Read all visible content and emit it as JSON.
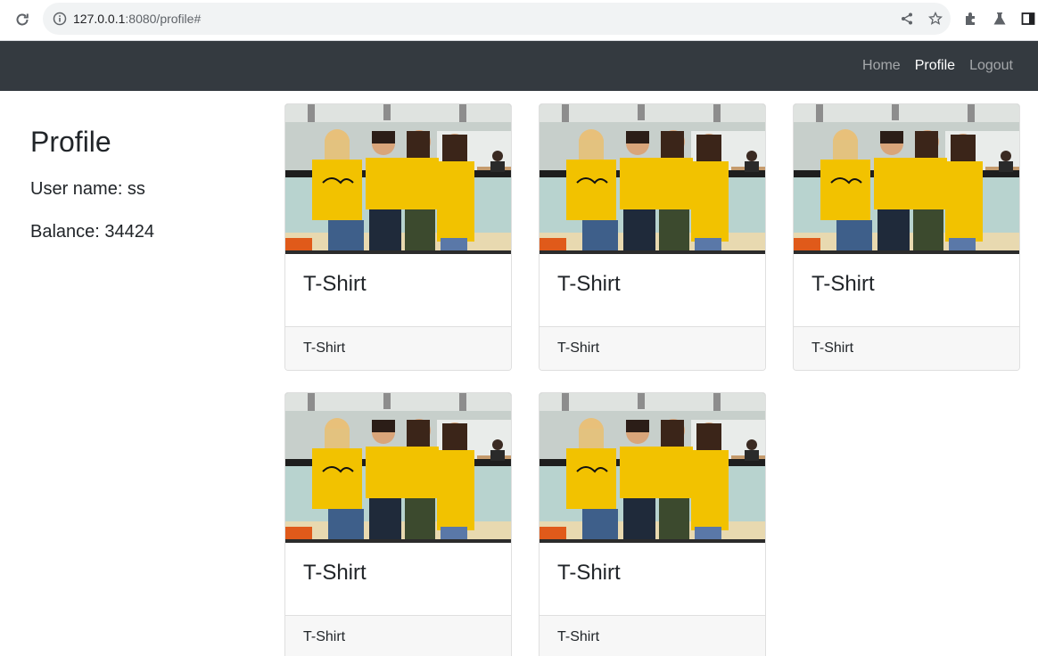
{
  "browser": {
    "url_host": "127.0.0.1",
    "url_path": ":8080/profile#",
    "icons": [
      "reload-icon",
      "site-info-icon",
      "share-icon",
      "bookmark-star-icon",
      "extensions-icon",
      "labs-flask-icon",
      "side-panel-icon"
    ]
  },
  "navbar": {
    "links": [
      {
        "label": "Home",
        "active": false
      },
      {
        "label": "Profile",
        "active": true
      },
      {
        "label": "Logout",
        "active": false
      }
    ]
  },
  "profile": {
    "heading": "Profile",
    "username_text": "User name: ss",
    "balance_text": "Balance: 34424"
  },
  "products": [
    {
      "title": "T-Shirt",
      "footer": "T-Shirt"
    },
    {
      "title": "T-Shirt",
      "footer": "T-Shirt"
    },
    {
      "title": "T-Shirt",
      "footer": "T-Shirt"
    },
    {
      "title": "T-Shirt",
      "footer": "T-Shirt"
    },
    {
      "title": "T-Shirt",
      "footer": "T-Shirt"
    }
  ],
  "colors": {
    "navbar_bg": "#343a40",
    "shirt_yellow": "#f2c200",
    "card_footer_bg": "#f7f7f7"
  }
}
